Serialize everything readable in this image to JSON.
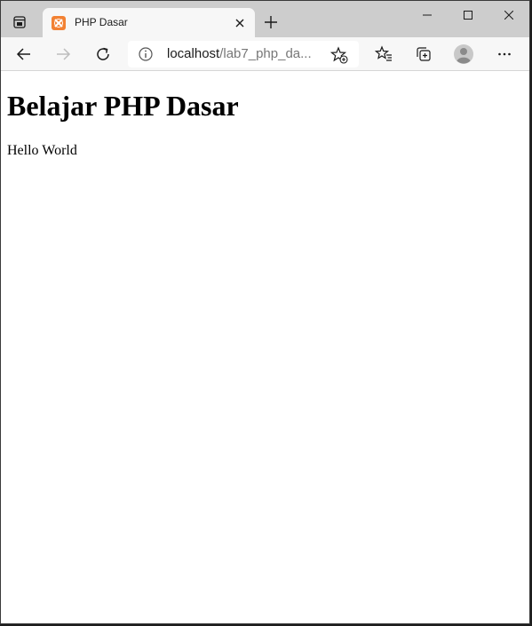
{
  "tab": {
    "title": "PHP Dasar",
    "favicon": "xampp-icon"
  },
  "address_bar": {
    "url_host": "localhost",
    "url_path": "/lab7_php_da...",
    "icons": [
      "info-icon",
      "add-favorite-icon"
    ]
  },
  "toolbar": {
    "icons": [
      "back-arrow-icon",
      "forward-arrow-icon",
      "refresh-icon",
      "favorites-icon",
      "collections-icon",
      "profile-icon",
      "more-icon"
    ]
  },
  "page": {
    "heading": "Belajar PHP Dasar",
    "text": "Hello World"
  },
  "colors": {
    "tab_bar": "#cdcdcd",
    "toolbar": "#f7f7f7",
    "favicon": "#f28133"
  }
}
